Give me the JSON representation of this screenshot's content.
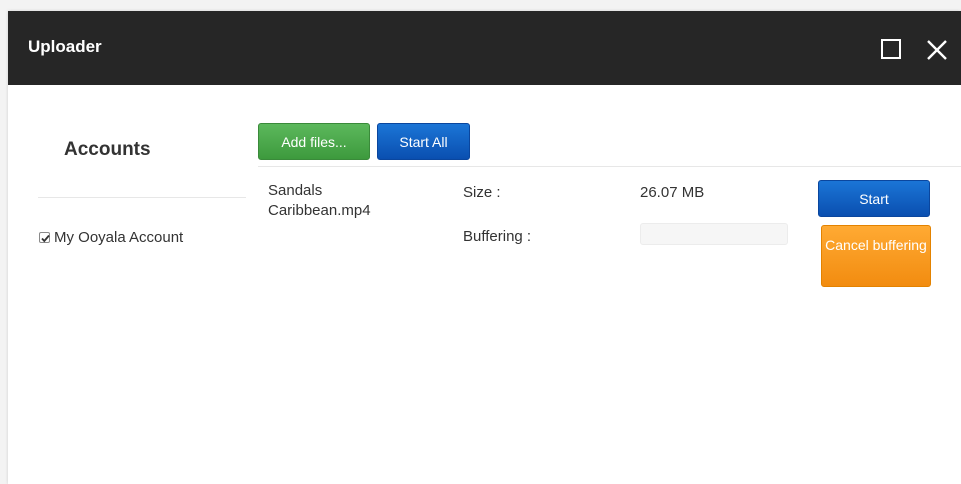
{
  "window": {
    "title": "Uploader"
  },
  "sidebar": {
    "heading": "Accounts",
    "accounts": [
      {
        "label": "My Ooyala Account",
        "checked": true
      }
    ]
  },
  "toolbar": {
    "add_files_label": "Add files...",
    "start_all_label": "Start All"
  },
  "upload": {
    "file_name": "Sandals Caribbean.mp4",
    "size_label": "Size :",
    "size_value": "26.07 MB",
    "buffering_label": "Buffering :",
    "buffering_progress": 0,
    "start_label": "Start",
    "cancel_label": "Cancel buffering"
  },
  "colors": {
    "titlebar": "#262626",
    "green_button": "#4cae4c",
    "blue_button": "#0d5ec4",
    "orange_button": "#f7941d"
  },
  "icons": {
    "maximize": "square-outline",
    "close": "x-mark",
    "checkbox": "checkmark"
  }
}
